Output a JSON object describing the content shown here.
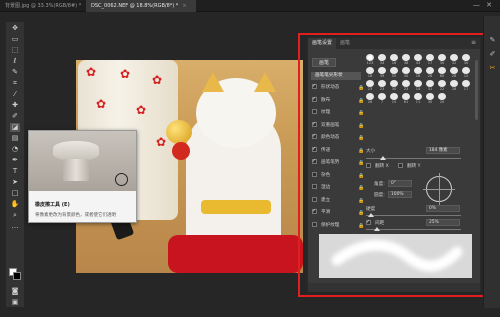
{
  "tabs": [
    {
      "label": "背景图.jpg @ 33.3%(RGB/8#) *",
      "close": "×"
    },
    {
      "label": "DSC_0062.NEF @ 18.8%(RGB/8*) *",
      "close": "×"
    }
  ],
  "window_controls": "— ✕",
  "tooltip": {
    "title": "橡皮擦工具 (E)",
    "desc": "将像素更改为背景颜色，或者使它们透明"
  },
  "panel": {
    "tabs": [
      "画笔设置",
      "画笔"
    ],
    "menu_icon": "≡",
    "preset_button": "画笔",
    "brush_tip_shape": "画笔笔尖形状",
    "options": [
      {
        "label": "形状动态",
        "checked": true
      },
      {
        "label": "散布",
        "checked": true
      },
      {
        "label": "纹理",
        "checked": false
      },
      {
        "label": "双重画笔",
        "checked": true
      },
      {
        "label": "颜色动态",
        "checked": true
      },
      {
        "label": "传递",
        "checked": true
      },
      {
        "label": "画笔笔势",
        "checked": true
      },
      {
        "label": "杂色",
        "checked": false
      },
      {
        "label": "湿边",
        "checked": false
      },
      {
        "label": "建立",
        "checked": false
      },
      {
        "label": "平滑",
        "checked": true
      },
      {
        "label": "保护纹理",
        "checked": false
      }
    ],
    "brush_sizes": [
      "123",
      "34",
      "18",
      "38",
      "43",
      "17",
      "30",
      "32",
      "30",
      "18",
      "39",
      "55",
      "30",
      "16",
      "26",
      "60",
      "28",
      "10",
      "23",
      "23",
      "30",
      "23",
      "14",
      "31",
      "22",
      "28",
      "17",
      "26",
      "7",
      "15",
      "61",
      "11",
      "30",
      "20"
    ],
    "size_label": "大小",
    "size_value": "184 像素",
    "flip_x": "翻转 X",
    "flip_y": "翻转 Y",
    "angle_label": "角度:",
    "angle_value": "0°",
    "roundness_label": "圆度:",
    "roundness_value": "100%",
    "hardness_label": "硬度",
    "hardness_value": "0%",
    "spacing_label": "间距",
    "spacing_value": "25%"
  },
  "colors": {
    "accent": "#e02020",
    "panel_bg": "#3a3a3a",
    "app_bg": "#262626"
  }
}
